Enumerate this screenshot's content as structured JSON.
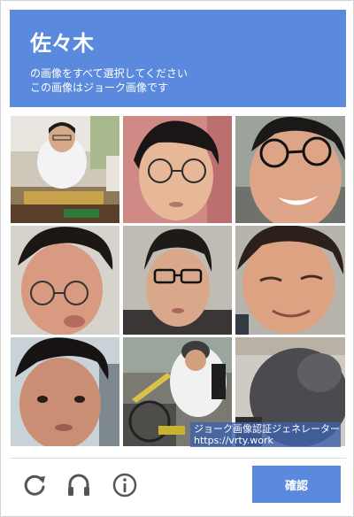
{
  "header": {
    "title": "佐々木",
    "instruction_line1": "の画像をすべて選択してください",
    "instruction_line2": "この画像はジョーク画像です"
  },
  "tiles": [
    {
      "id": 1
    },
    {
      "id": 2
    },
    {
      "id": 3
    },
    {
      "id": 4
    },
    {
      "id": 5
    },
    {
      "id": 6
    },
    {
      "id": 7
    },
    {
      "id": 8
    },
    {
      "id": 9
    }
  ],
  "watermark": {
    "line1": "ジョーク画像認証ジェネレーター",
    "line2": "https://vrty.work"
  },
  "footer": {
    "reload_icon": "reload-icon",
    "audio_icon": "headphones-icon",
    "info_icon": "info-icon",
    "confirm_label": "確認"
  },
  "colors": {
    "accent": "#5a89dd",
    "icon": "#555555"
  }
}
